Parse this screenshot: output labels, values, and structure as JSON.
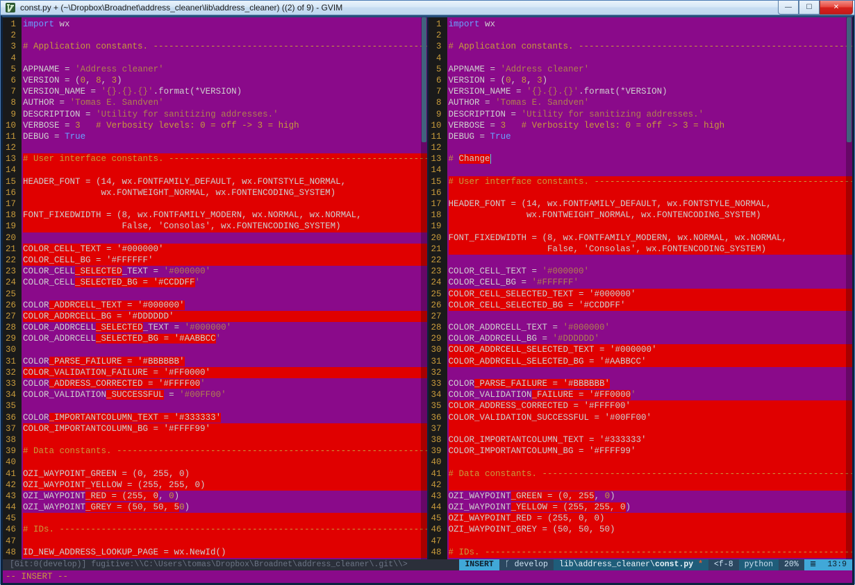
{
  "title": "const.py + (~\\Dropbox\\Broadnet\\address_cleaner\\lib\\address_cleaner) ((2) of 9) - GVIM",
  "cmdline": "-- INSERT --",
  "status_left": {
    "left": "[Git:0(develop)]  fugitive:\\\\C:\\Users\\tomas\\Dropbox\\Broadnet\\address_cleaner\\.git\\\\>"
  },
  "status_right": {
    "insert": "INSERT",
    "branch": "develop",
    "path": "lib\\address_cleaner\\",
    "file": "const.py",
    "star": "*",
    "f8": "<f-8",
    "py": "python",
    "pct": "20%",
    "loc": "13:9"
  },
  "left_lines": [
    {
      "n": 1,
      "h": 0,
      "html": "<span class='c-kw'>import</span> wx"
    },
    {
      "n": 2,
      "h": 0,
      "html": ""
    },
    {
      "n": 3,
      "h": 0,
      "html": "<span class='c-cm'># Application constants. ------------------------------------------------------</span>"
    },
    {
      "n": 4,
      "h": 0,
      "html": ""
    },
    {
      "n": 5,
      "h": 0,
      "html": "APPNAME <span class='c-nm'>=</span> <span class='c-st'>'Address cleaner'</span>"
    },
    {
      "n": 6,
      "h": 0,
      "html": "VERSION <span class='c-nm'>=</span> (<span class='c-sp'>0</span>, <span class='c-sp'>8</span>, <span class='c-sp'>3</span>)"
    },
    {
      "n": 7,
      "h": 0,
      "html": "VERSION_NAME <span class='c-nm'>=</span> <span class='c-st'>'{}.{}.{}'</span>.format(*VERSION)"
    },
    {
      "n": 8,
      "h": 0,
      "html": "AUTHOR <span class='c-nm'>=</span> <span class='c-st'>'Tomas E. Sandven'</span>"
    },
    {
      "n": 9,
      "h": 0,
      "html": "DESCRIPTION <span class='c-nm'>=</span> <span class='c-st'>'Utility for sanitizing addresses.'</span>"
    },
    {
      "n": 10,
      "h": 0,
      "html": "VERBOSE <span class='c-nm'>=</span> <span class='c-sp'>3</span>   <span class='c-cm'># Verbosity levels: 0 = off -> 3 = high</span>"
    },
    {
      "n": 11,
      "h": 0,
      "html": "DEBUG <span class='c-nm'>=</span> <span class='c-tr'>True</span>"
    },
    {
      "n": 12,
      "h": 0,
      "html": ""
    },
    {
      "n": 13,
      "h": 1,
      "html": "<span class='c-cm'># User interface constants. ---------------------------------------------------</span>"
    },
    {
      "n": 14,
      "h": 1,
      "html": ""
    },
    {
      "n": 15,
      "h": 1,
      "html": "HEADER_FONT = (14, wx.FONTFAMILY_DEFAULT, wx.FONTSTYLE_NORMAL,"
    },
    {
      "n": 16,
      "h": 1,
      "html": "               wx.FONTWEIGHT_NORMAL, wx.FONTENCODING_SYSTEM)"
    },
    {
      "n": 17,
      "h": 1,
      "html": ""
    },
    {
      "n": 18,
      "h": 1,
      "html": "FONT_FIXEDWIDTH = (8, wx.FONTFAMILY_MODERN, wx.NORMAL, wx.NORMAL,"
    },
    {
      "n": 19,
      "h": 1,
      "html": "                   False, 'Consolas', wx.FONTENCODING_SYSTEM)"
    },
    {
      "n": 20,
      "h": 0,
      "html": ""
    },
    {
      "n": 21,
      "h": 1,
      "html": "COLOR_CELL_TEXT = '#000000'"
    },
    {
      "n": 22,
      "h": 1,
      "html": "COLOR_CELL_BG = '#FFFFFF'"
    },
    {
      "n": 23,
      "h": 0,
      "html": "COLOR_CELL<span class='hl'>_SELECTED</span>_TEXT = <span class='c-st'>'#000000'</span>"
    },
    {
      "n": 24,
      "h": 0,
      "html": "COLOR_CELL<span class='hl'>_SELECTED_BG = '#CCDDFF</span><span class='c-st'>'</span>"
    },
    {
      "n": 25,
      "h": 0,
      "html": ""
    },
    {
      "n": 26,
      "h": 0,
      "html": "COLOR<span class='hl'>_ADDRCELL_TEXT = '#000000'</span>"
    },
    {
      "n": 27,
      "h": 1,
      "html": "COLOR_ADDRCELL_BG = '#DDDDDD'"
    },
    {
      "n": 28,
      "h": 0,
      "html": "COLOR_ADDRCELL<span class='hl'>_SELECTED</span>_TEXT = <span class='c-st'>'#000000'</span>"
    },
    {
      "n": 29,
      "h": 0,
      "html": "COLOR_ADDRCELL<span class='hl'>_SELECTED_BG = '#AABBCC</span><span class='c-st'>'</span>"
    },
    {
      "n": 30,
      "h": 0,
      "html": ""
    },
    {
      "n": 31,
      "h": 0,
      "html": "COLOR<span class='hl'>_PARSE_FAILURE = '#BBBBBB'</span>"
    },
    {
      "n": 32,
      "h": 1,
      "html": "COLOR_VALIDATION_FAILURE = '#FF0000'"
    },
    {
      "n": 33,
      "h": 0,
      "html": "COLOR<span class='hl'>_ADDRESS_CORRECTED = '#FFFF00</span><span class='c-st'>'</span>"
    },
    {
      "n": 34,
      "h": 0,
      "html": "COLOR_VALIDATION<span class='hl'>_SUCCESSFUL</span> = <span class='c-st'>'#00FF00'</span>"
    },
    {
      "n": 35,
      "h": 0,
      "html": ""
    },
    {
      "n": 36,
      "h": 0,
      "html": "COLOR<span class='hl'>_IMPORTANTCOLUMN_TEXT = '#333333'</span>"
    },
    {
      "n": 37,
      "h": 1,
      "html": "COLOR_IMPORTANTCOLUMN_BG = '#FFFF99'"
    },
    {
      "n": 38,
      "h": 1,
      "html": ""
    },
    {
      "n": 39,
      "h": 1,
      "html": "<span class='c-cm'># Data constants. --------------------------------------------------------------</span>"
    },
    {
      "n": 40,
      "h": 1,
      "html": ""
    },
    {
      "n": 41,
      "h": 1,
      "html": "OZI_WAYPOINT_GREEN = (0, 255, 0)"
    },
    {
      "n": 42,
      "h": 1,
      "html": "OZI_WAYPOINT_YELLOW = (255, 255, 0)"
    },
    {
      "n": 43,
      "h": 0,
      "html": "OZI_WAYPOINT<span class='hl'>_RED = (255, 0</span>, <span class='c-sp'>0</span>)"
    },
    {
      "n": 44,
      "h": 0,
      "html": "OZI_WAYPOINT<span class='hl'>_GREY = (50, 50, 5</span><span class='c-sp'>0</span>)"
    },
    {
      "n": 45,
      "h": 1,
      "html": ""
    },
    {
      "n": 46,
      "h": 1,
      "html": "<span class='c-cm'># IDs. -------------------------------------------------------------------------</span>"
    },
    {
      "n": 47,
      "h": 1,
      "html": ""
    },
    {
      "n": 48,
      "h": 1,
      "html": "ID_NEW_ADDRESS_LOOKUP_PAGE = wx.NewId()"
    }
  ],
  "right_lines": [
    {
      "n": 1,
      "h": 0,
      "html": "<span class='c-kw'>import</span> wx"
    },
    {
      "n": 2,
      "h": 0,
      "html": ""
    },
    {
      "n": 3,
      "h": 0,
      "html": "<span class='c-cm'># Application constants. ------------------------------------------------------</span>"
    },
    {
      "n": 4,
      "h": 0,
      "html": ""
    },
    {
      "n": 5,
      "h": 0,
      "html": "APPNAME <span class='c-nm'>=</span> <span class='c-st'>'Address cleaner'</span>"
    },
    {
      "n": 6,
      "h": 0,
      "html": "VERSION <span class='c-nm'>=</span> (<span class='c-sp'>0</span>, <span class='c-sp'>8</span>, <span class='c-sp'>3</span>)"
    },
    {
      "n": 7,
      "h": 0,
      "html": "VERSION_NAME <span class='c-nm'>=</span> <span class='c-st'>'{}.{}.{}'</span>.format(*VERSION)"
    },
    {
      "n": 8,
      "h": 0,
      "html": "AUTHOR <span class='c-nm'>=</span> <span class='c-st'>'Tomas E. Sandven'</span>"
    },
    {
      "n": 9,
      "h": 0,
      "html": "DESCRIPTION <span class='c-nm'>=</span> <span class='c-st'>'Utility for sanitizing addresses.'</span>"
    },
    {
      "n": 10,
      "h": 0,
      "html": "VERBOSE <span class='c-nm'>=</span> <span class='c-sp'>3</span>   <span class='c-cm'># Verbosity levels: 0 = off -> 3 = high</span>"
    },
    {
      "n": 11,
      "h": 0,
      "html": "DEBUG <span class='c-nm'>=</span> <span class='c-tr'>True</span>"
    },
    {
      "n": 12,
      "h": 0,
      "html": ""
    },
    {
      "n": 13,
      "h": 0,
      "html": "<span class='c-cm'># </span><span class='hl'>Change</span><span class='cursor'></span>"
    },
    {
      "n": 14,
      "h": 0,
      "html": ""
    },
    {
      "n": 15,
      "h": 1,
      "html": "<span class='c-cm'># User interface constants. ---------------------------------------------------</span>"
    },
    {
      "n": 16,
      "h": 1,
      "html": ""
    },
    {
      "n": 17,
      "h": 1,
      "html": "HEADER_FONT = (14, wx.FONTFAMILY_DEFAULT, wx.FONTSTYLE_NORMAL,"
    },
    {
      "n": 18,
      "h": 1,
      "html": "               wx.FONTWEIGHT_NORMAL, wx.FONTENCODING_SYSTEM)"
    },
    {
      "n": 19,
      "h": 1,
      "html": ""
    },
    {
      "n": 20,
      "h": 1,
      "html": "FONT_FIXEDWIDTH = (8, wx.FONTFAMILY_MODERN, wx.NORMAL, wx.NORMAL,"
    },
    {
      "n": 21,
      "h": 1,
      "html": "                   False, 'Consolas', wx.FONTENCODING_SYSTEM)"
    },
    {
      "n": 22,
      "h": 0,
      "html": ""
    },
    {
      "n": 23,
      "h": 0,
      "html": "COLOR_CELL_TEXT = <span class='c-st'>'#000000'</span>"
    },
    {
      "n": 24,
      "h": 0,
      "html": "COLOR_CELL_BG = <span class='c-st'>'#FFFFFF'</span>"
    },
    {
      "n": 25,
      "h": 1,
      "html": "COLOR_CELL_SELECTED_TEXT = '#000000'"
    },
    {
      "n": 26,
      "h": 1,
      "html": "COLOR_CELL_SELECTED_BG = '#CCDDFF'"
    },
    {
      "n": 27,
      "h": 0,
      "html": ""
    },
    {
      "n": 28,
      "h": 0,
      "html": "COLOR_ADDRCELL_TEXT = <span class='c-st'>'#000000'</span>"
    },
    {
      "n": 29,
      "h": 0,
      "html": "COLOR_ADDRCELL_BG = <span class='c-st'>'#DDDDDD'</span>"
    },
    {
      "n": 30,
      "h": 1,
      "html": "COLOR_ADDRCELL_SELECTED_TEXT = '#000000'"
    },
    {
      "n": 31,
      "h": 1,
      "html": "COLOR_ADDRCELL_SELECTED_BG = '#AABBCC'"
    },
    {
      "n": 32,
      "h": 0,
      "html": ""
    },
    {
      "n": 33,
      "h": 0,
      "html": "COLOR<span class='hl'>_PARSE_FAILURE = '#BBBBBB'</span>"
    },
    {
      "n": 34,
      "h": 0,
      "html": "COLOR_VALIDATION<span class='hl'>_FAILURE = '#FF0000</span><span class='c-st'>'</span>"
    },
    {
      "n": 35,
      "h": 1,
      "html": "COLOR_ADDRESS_CORRECTED = '#FFFF00'"
    },
    {
      "n": 36,
      "h": 1,
      "html": "COLOR_VALIDATION_SUCCESSFUL = '#00FF00'"
    },
    {
      "n": 37,
      "h": 1,
      "html": ""
    },
    {
      "n": 38,
      "h": 1,
      "html": "COLOR_IMPORTANTCOLUMN_TEXT = '#333333'"
    },
    {
      "n": 39,
      "h": 1,
      "html": "COLOR_IMPORTANTCOLUMN_BG = '#FFFF99'"
    },
    {
      "n": 40,
      "h": 1,
      "html": ""
    },
    {
      "n": 41,
      "h": 1,
      "html": "<span class='c-cm'># Data constants. --------------------------------------------------------------</span>"
    },
    {
      "n": 42,
      "h": 1,
      "html": ""
    },
    {
      "n": 43,
      "h": 0,
      "html": "OZI_WAYPOINT<span class='hl'>_GREEN = (0, 255</span>, <span class='c-sp'>0</span>)"
    },
    {
      "n": 44,
      "h": 0,
      "html": "OZI_WAYPOINT<span class='hl'>_YELLOW = (255, 255, 0</span>)"
    },
    {
      "n": 45,
      "h": 1,
      "html": "OZI_WAYPOINT_RED = (255, 0, 0)"
    },
    {
      "n": 46,
      "h": 1,
      "html": "OZI_WAYPOINT_GREY = (50, 50, 50)"
    },
    {
      "n": 47,
      "h": 1,
      "html": ""
    },
    {
      "n": 48,
      "h": 1,
      "html": "<span class='c-cm'># IDs. -------------------------------------------------------------------------</span>"
    }
  ]
}
